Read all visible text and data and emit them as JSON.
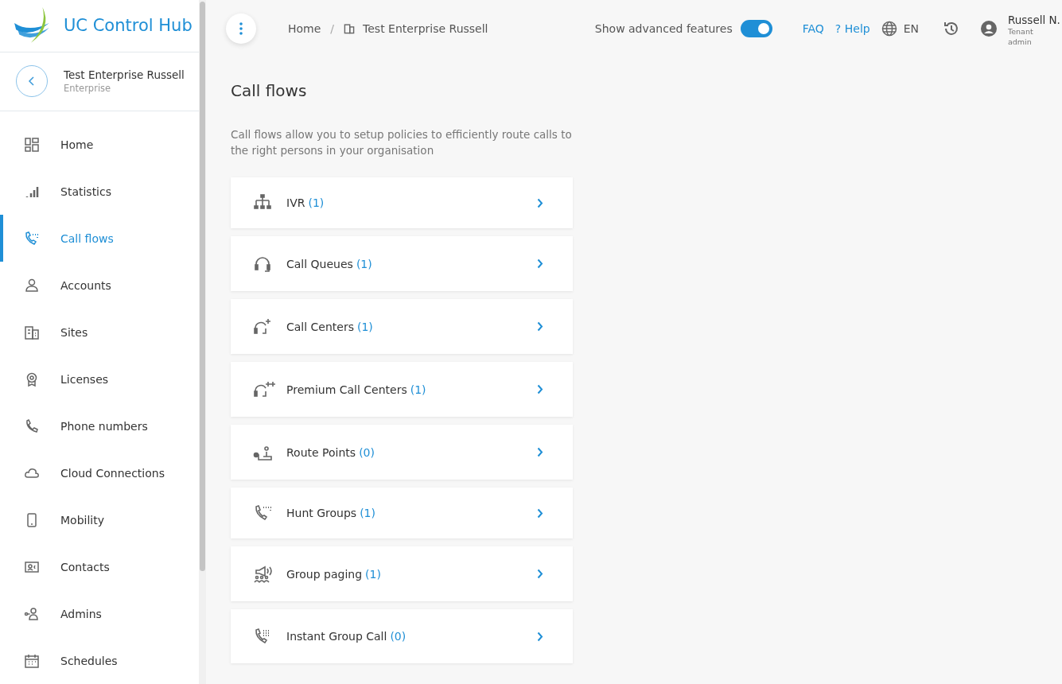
{
  "brand": {
    "name": "UC Control Hub"
  },
  "context": {
    "title": "Test Enterprise Russell",
    "subtitle": "Enterprise"
  },
  "sidebar": {
    "items": [
      {
        "label": "Home",
        "selected": false
      },
      {
        "label": "Statistics",
        "selected": false
      },
      {
        "label": "Call flows",
        "selected": true
      },
      {
        "label": "Accounts",
        "selected": false
      },
      {
        "label": "Sites",
        "selected": false
      },
      {
        "label": "Licenses",
        "selected": false
      },
      {
        "label": "Phone numbers",
        "selected": false
      },
      {
        "label": "Cloud Connections",
        "selected": false
      },
      {
        "label": "Mobility",
        "selected": false
      },
      {
        "label": "Contacts",
        "selected": false
      },
      {
        "label": "Admins",
        "selected": false
      },
      {
        "label": "Schedules",
        "selected": false
      }
    ]
  },
  "breadcrumb": [
    "Home",
    "/",
    "Test Enterprise Russell"
  ],
  "advanced_toggle": {
    "label": "Show advanced features",
    "on": true
  },
  "header_links": {
    "faq": "FAQ",
    "help_icon": "?",
    "help": "Help",
    "language": "EN"
  },
  "user": {
    "name": "Russell N.",
    "role_line_1": "Tenant",
    "role_line_2": "admin"
  },
  "page": {
    "title": "Call flows",
    "description": "Call flows allow you to setup policies to efficiently route calls to the right persons in your organisation"
  },
  "flows": [
    {
      "label": "IVR",
      "count": "(1)"
    },
    {
      "label": "Call Queues",
      "count": "(1)"
    },
    {
      "label": "Call Centers",
      "count": "(1)"
    },
    {
      "label": "Premium Call Centers",
      "count": "(1)"
    },
    {
      "label": "Route Points",
      "count": "(0)"
    },
    {
      "label": "Hunt Groups",
      "count": "(1)"
    },
    {
      "label": "Group paging",
      "count": "(1)"
    },
    {
      "label": "Instant Group Call",
      "count": "(0)"
    }
  ]
}
